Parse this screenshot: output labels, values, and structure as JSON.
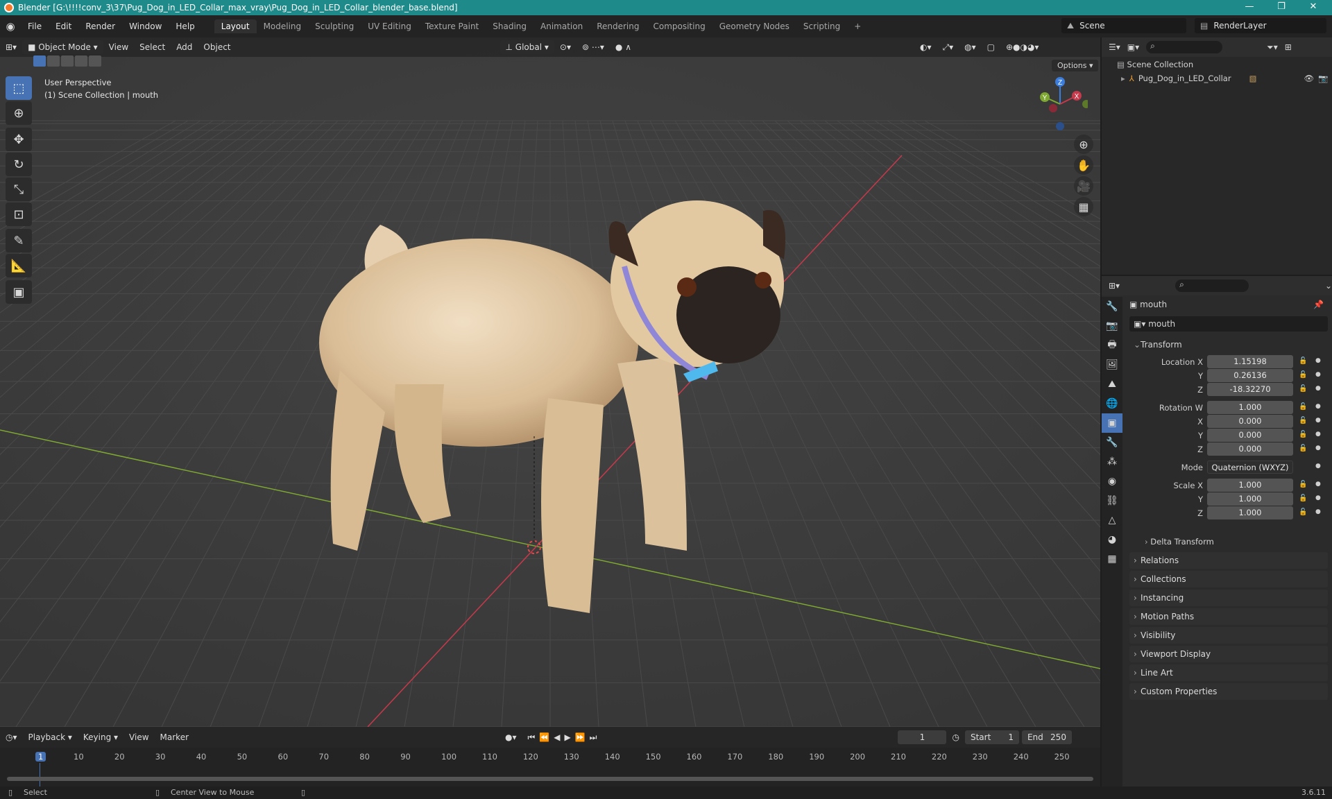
{
  "window": {
    "title": "Blender [G:\\!!!!conv_3\\37\\Pug_Dog_in_LED_Collar_max_vray\\Pug_Dog_in_LED_Collar_blender_base.blend]",
    "controls": [
      "—",
      "❐",
      "✕"
    ]
  },
  "menu": {
    "items": [
      "File",
      "Edit",
      "Render",
      "Window",
      "Help"
    ],
    "workspaces": [
      "Layout",
      "Modeling",
      "Sculpting",
      "UV Editing",
      "Texture Paint",
      "Shading",
      "Animation",
      "Rendering",
      "Compositing",
      "Geometry Nodes",
      "Scripting"
    ],
    "add_workspace": "+",
    "scene": "Scene",
    "view_layer": "RenderLayer"
  },
  "viewport": {
    "mode": "Object Mode",
    "menus": [
      "View",
      "Select",
      "Add",
      "Object"
    ],
    "orientation": "Global",
    "options_label": "Options",
    "overlay_line1": "User Perspective",
    "overlay_line2": "(1) Scene Collection | mouth",
    "gizmo": {
      "x": "X",
      "y": "Y",
      "z": "Z"
    },
    "tools": [
      "select-box-icon",
      "cursor-icon",
      "move-icon",
      "rotate-icon",
      "scale-icon",
      "transform-icon",
      "annotate-icon",
      "measure-icon",
      "add-cube-icon"
    ]
  },
  "outliner": {
    "root": "Scene Collection",
    "items": [
      {
        "label": "Pug_Dog_in_LED_Collar"
      }
    ]
  },
  "properties": {
    "object_name": "mouth",
    "data_name": "mouth",
    "transform_label": "Transform",
    "location": {
      "label": "Location X",
      "x": "1.15198",
      "y_label": "Y",
      "y": "0.26136",
      "z_label": "Z",
      "z": "-18.32270"
    },
    "rotation": {
      "label": "Rotation W",
      "w": "1.000",
      "x_label": "X",
      "x": "0.000",
      "y_label": "Y",
      "y": "0.000",
      "z_label": "Z",
      "z": "0.000"
    },
    "mode": {
      "label": "Mode",
      "value": "Quaternion (WXYZ)"
    },
    "scale": {
      "label": "Scale X",
      "x": "1.000",
      "y_label": "Y",
      "y": "1.000",
      "z_label": "Z",
      "z": "1.000"
    },
    "delta_transform": "Delta Transform",
    "sections": [
      "Relations",
      "Collections",
      "Instancing",
      "Motion Paths",
      "Visibility",
      "Viewport Display",
      "Line Art",
      "Custom Properties"
    ]
  },
  "timeline": {
    "menus": [
      "Playback",
      "Keying",
      "View",
      "Marker"
    ],
    "current_frame": "1",
    "start_label": "Start",
    "start": "1",
    "end_label": "End",
    "end": "250",
    "frames": [
      "1",
      "10",
      "20",
      "30",
      "40",
      "50",
      "60",
      "70",
      "80",
      "90",
      "100",
      "110",
      "120",
      "130",
      "140",
      "150",
      "160",
      "170",
      "180",
      "190",
      "200",
      "210",
      "220",
      "230",
      "240",
      "250"
    ]
  },
  "statusbar": {
    "left": "Select",
    "middle": "Center View to Mouse",
    "version": "3.6.11"
  },
  "colors": {
    "accent": "#4772b3",
    "titlebar": "#1f8a8a",
    "x_axis": "#c7394b",
    "y_axis": "#7ea831",
    "z_axis": "#3b7ddd"
  }
}
